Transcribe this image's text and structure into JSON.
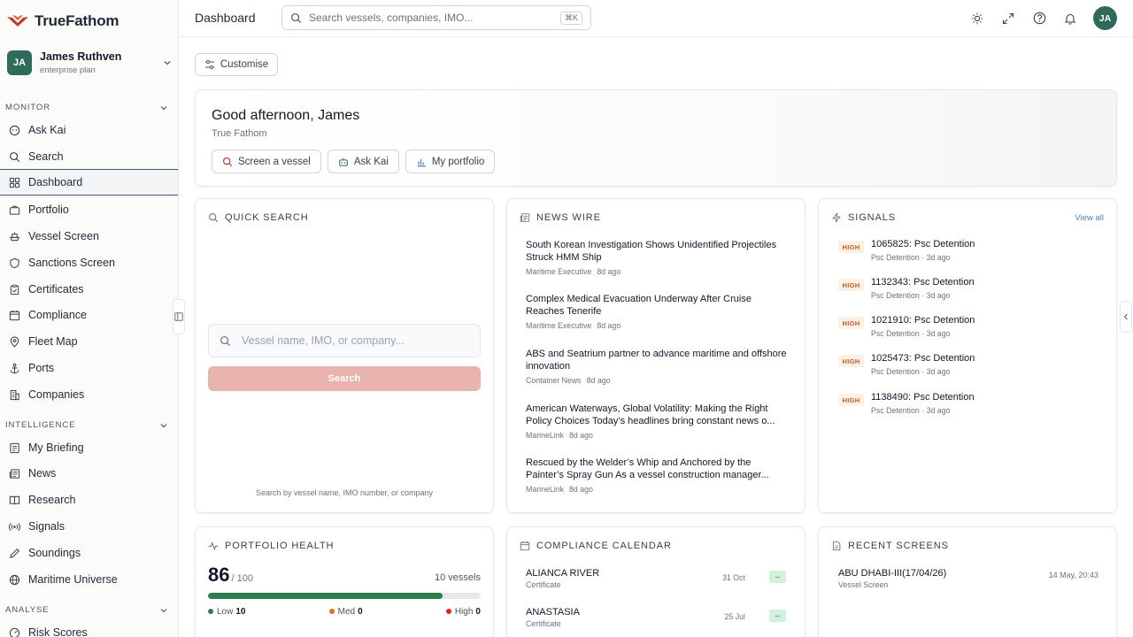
{
  "brand": {
    "prefix": "True",
    "suffix": "Fathom"
  },
  "user": {
    "initials": "JA",
    "name": "James Ruthven",
    "plan": "enterprise plan"
  },
  "sidebar": {
    "sections": [
      {
        "label": "MONITOR"
      },
      {
        "label": "INTELLIGENCE"
      },
      {
        "label": "ANALYSE"
      }
    ],
    "items": [
      {
        "label": "Ask Kai",
        "icon": "kai-icon"
      },
      {
        "label": "Search",
        "icon": "search-icon"
      },
      {
        "label": "Dashboard",
        "icon": "grid-icon"
      },
      {
        "label": "Portfolio",
        "icon": "briefcase-icon"
      },
      {
        "label": "Vessel Screen",
        "icon": "ship-icon"
      },
      {
        "label": "Sanctions Screen",
        "icon": "shield-icon"
      },
      {
        "label": "Certificates",
        "icon": "clipboard-icon"
      },
      {
        "label": "Compliance",
        "icon": "calendar-icon"
      },
      {
        "label": "Fleet Map",
        "icon": "map-pin-icon"
      },
      {
        "label": "Ports",
        "icon": "anchor-icon"
      },
      {
        "label": "Companies",
        "icon": "building-icon"
      },
      {
        "label": "My Briefing",
        "icon": "briefing-icon"
      },
      {
        "label": "News",
        "icon": "newspaper-icon"
      },
      {
        "label": "Research",
        "icon": "book-icon"
      },
      {
        "label": "Signals",
        "icon": "radio-icon"
      },
      {
        "label": "Soundings",
        "icon": "pen-icon"
      },
      {
        "label": "Maritime Universe",
        "icon": "globe-icon"
      },
      {
        "label": "Risk Scores",
        "icon": "gauge-icon"
      }
    ]
  },
  "header": {
    "title": "Dashboard",
    "search_placeholder": "Search vessels, companies, IMO...",
    "shortcut": "⌘K",
    "avatar": "JA"
  },
  "toolbar": {
    "customise_label": "Customise"
  },
  "greeting": {
    "title": "Good afternoon, James",
    "subtitle": "True Fathom",
    "actions": [
      {
        "label": "Screen a vessel",
        "icon": "search-icon"
      },
      {
        "label": "Ask Kai",
        "icon": "robot-icon"
      },
      {
        "label": "My portfolio",
        "icon": "bar-chart-icon"
      }
    ]
  },
  "quick_search": {
    "title": "QUICK SEARCH",
    "placeholder": "Vessel name, IMO, or company...",
    "button": "Search",
    "help": "Search by vessel name, IMO number, or company"
  },
  "news_wire": {
    "title": "NEWS WIRE",
    "items": [
      {
        "title": "South Korean Investigation Shows Unidentified Projectiles Struck HMM Ship",
        "source": "Maritime Executive",
        "age": "8d ago"
      },
      {
        "title": "Complex Medical Evacuation Underway After Cruise Reaches Tenerife",
        "source": "Maritime Executive",
        "age": "8d ago"
      },
      {
        "title": "ABS and Seatrium partner to advance maritime and offshore innovation",
        "source": "Container News",
        "age": "8d ago"
      },
      {
        "title": "American Waterways, Global Volatility: Making the Right Policy Choices Today’s headlines bring constant news o...",
        "source": "MarineLink",
        "age": "8d ago"
      },
      {
        "title": "Rescued by the Welder’s Whip and Anchored by the Painter’s Spray Gun As a vessel construction manager...",
        "source": "MarineLink",
        "age": "8d ago"
      }
    ]
  },
  "signals": {
    "title": "SIGNALS",
    "view_all": "View all",
    "items": [
      {
        "level": "HIGH",
        "title": "1065825: Psc Detention",
        "meta": "Psc Detention · 3d ago"
      },
      {
        "level": "HIGH",
        "title": "1132343: Psc Detention",
        "meta": "Psc Detention · 3d ago"
      },
      {
        "level": "HIGH",
        "title": "1021910: Psc Detention",
        "meta": "Psc Detention · 3d ago"
      },
      {
        "level": "HIGH",
        "title": "1025473: Psc Detention",
        "meta": "Psc Detention · 3d ago"
      },
      {
        "level": "HIGH",
        "title": "1138490: Psc Detention",
        "meta": "Psc Detention · 3d ago"
      }
    ]
  },
  "portfolio_health": {
    "title": "PORTFOLIO HEALTH",
    "score": "86",
    "out_of": "/ 100",
    "score_fraction": 0.86,
    "vessels": "10 vessels",
    "legend": [
      {
        "label": "Low",
        "count": "10",
        "color": "#2e7d4f"
      },
      {
        "label": "Med",
        "count": "0",
        "color": "#d97706"
      },
      {
        "label": "High",
        "count": "0",
        "color": "#dc2626"
      }
    ]
  },
  "compliance_calendar": {
    "title": "COMPLIANCE CALENDAR",
    "items": [
      {
        "name": "ALIANCA RIVER",
        "type": "Certificate",
        "date": "31 Oct",
        "status": "--"
      },
      {
        "name": "ANASTASIA",
        "type": "Certificate",
        "date": "25 Jul",
        "status": "--"
      }
    ]
  },
  "recent_screens": {
    "title": "RECENT SCREENS",
    "items": [
      {
        "name": "ABU DHABI-III(17/04/26)",
        "type": "Vessel Screen",
        "date": "14 May, 20:43"
      }
    ]
  },
  "colors": {
    "accent": "#c0392b",
    "avatar": "#2f6b5a",
    "healthy": "#2e7d4f",
    "search_button": "#e9b4ad"
  }
}
